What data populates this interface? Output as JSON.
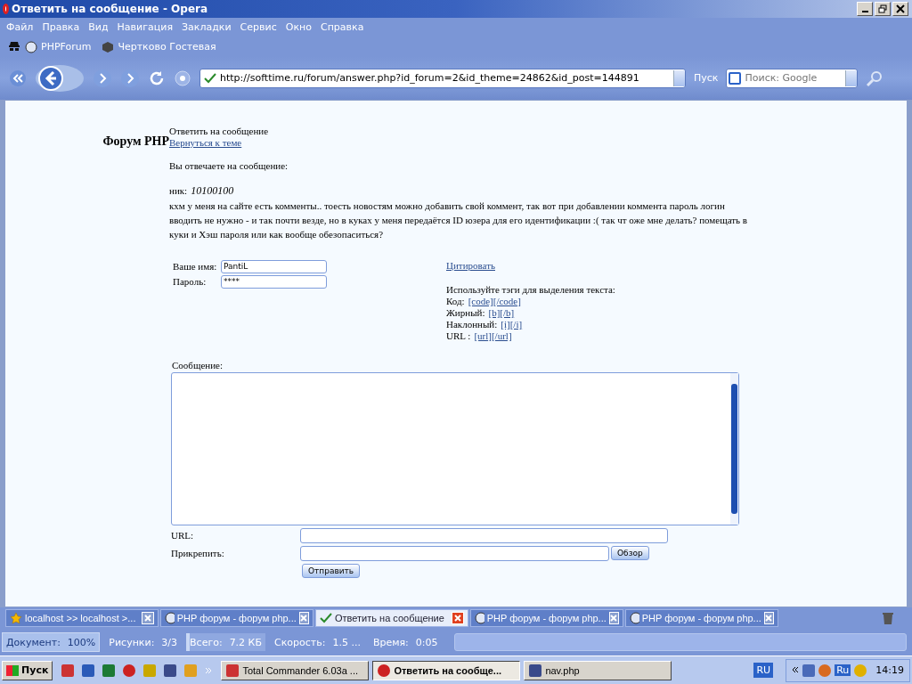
{
  "window": {
    "title": "Ответить на сообщение - Opera"
  },
  "menu": [
    "Файл",
    "Правка",
    "Вид",
    "Навигация",
    "Закладки",
    "Сервис",
    "Окно",
    "Справка"
  ],
  "bookmarks": [
    "PHPForum",
    "Чертково Гостевая"
  ],
  "address": {
    "value": "http://softtime.ru/forum/answer.php?id_forum=2&id_theme=24862&id_post=144891",
    "go": "Пуск",
    "search_placeholder": "Поиск: Google"
  },
  "page": {
    "forum_title": "Форум PHP",
    "heading": "Ответить на сообщение",
    "back_link": "Вернуться к теме",
    "reply_intro": "Вы отвечаете на сообщение:",
    "nick_label": "ник:",
    "nick": "10100100",
    "message": "кхм у меня на сайте есть комменты.. тоесть новостям можно добавить свой коммент, так вот при добавлении коммента пароль логин вводить не нужно - и так почти везде, но в куках у меня передаётся ID юзера для его идентификации :( так чт оже мне делать? помещать в куки и Хэш пароля или как вообще обезопаситься?",
    "name_label": "Ваше имя:",
    "name_value": "PantiL",
    "password_label": "Пароль:",
    "password_value": "****",
    "quote_link": "Цитировать",
    "tags_hint": "Используйте тэги для выделения текста:",
    "tags": [
      {
        "label": "Код:",
        "links": [
          "[code]",
          "[/code]"
        ]
      },
      {
        "label": "Жирный:",
        "links": [
          "[b]",
          "[/b]"
        ]
      },
      {
        "label": "Наклонный:",
        "links": [
          "[i]",
          "[/i]"
        ]
      },
      {
        "label": "URL :",
        "links": [
          "[url]",
          "[/url]"
        ]
      }
    ],
    "message_label": "Сообщение:",
    "url_label": "URL:",
    "attach_label": "Прикрепить:",
    "browse_button": "Обзор",
    "submit_button": "Отправить"
  },
  "tabs": [
    {
      "label": "localhost >> localhost >...",
      "selected": false,
      "kind": "star"
    },
    {
      "label": "PHP форум - форум php...",
      "selected": false,
      "kind": "php"
    },
    {
      "label": "Ответить на сообщение",
      "selected": true,
      "kind": "check"
    },
    {
      "label": "PHP форум - форум php...",
      "selected": false,
      "kind": "php"
    },
    {
      "label": "PHP форум - форум php...",
      "selected": false,
      "kind": "php"
    }
  ],
  "status_bar": [
    {
      "label": "Документ:",
      "value": "100%"
    },
    {
      "label": "Рисунки:",
      "value": "3/3"
    },
    {
      "label": "Всего:",
      "value": "7.2 КБ"
    },
    {
      "label": "Скорость:",
      "value": "1.5 ..."
    },
    {
      "label": "Время:",
      "value": "0:05"
    }
  ],
  "load_progress": {
    "level": 0
  },
  "taskbar": {
    "start": "Пуск",
    "buttons": [
      {
        "label": "Total Commander 6.03a ...",
        "selected": false
      },
      {
        "label": "Ответить на сообще...",
        "selected": true
      },
      {
        "label": "nav.php",
        "selected": false
      }
    ],
    "lang": "RU",
    "tray_lang": "Ru",
    "clock": "14:19"
  }
}
